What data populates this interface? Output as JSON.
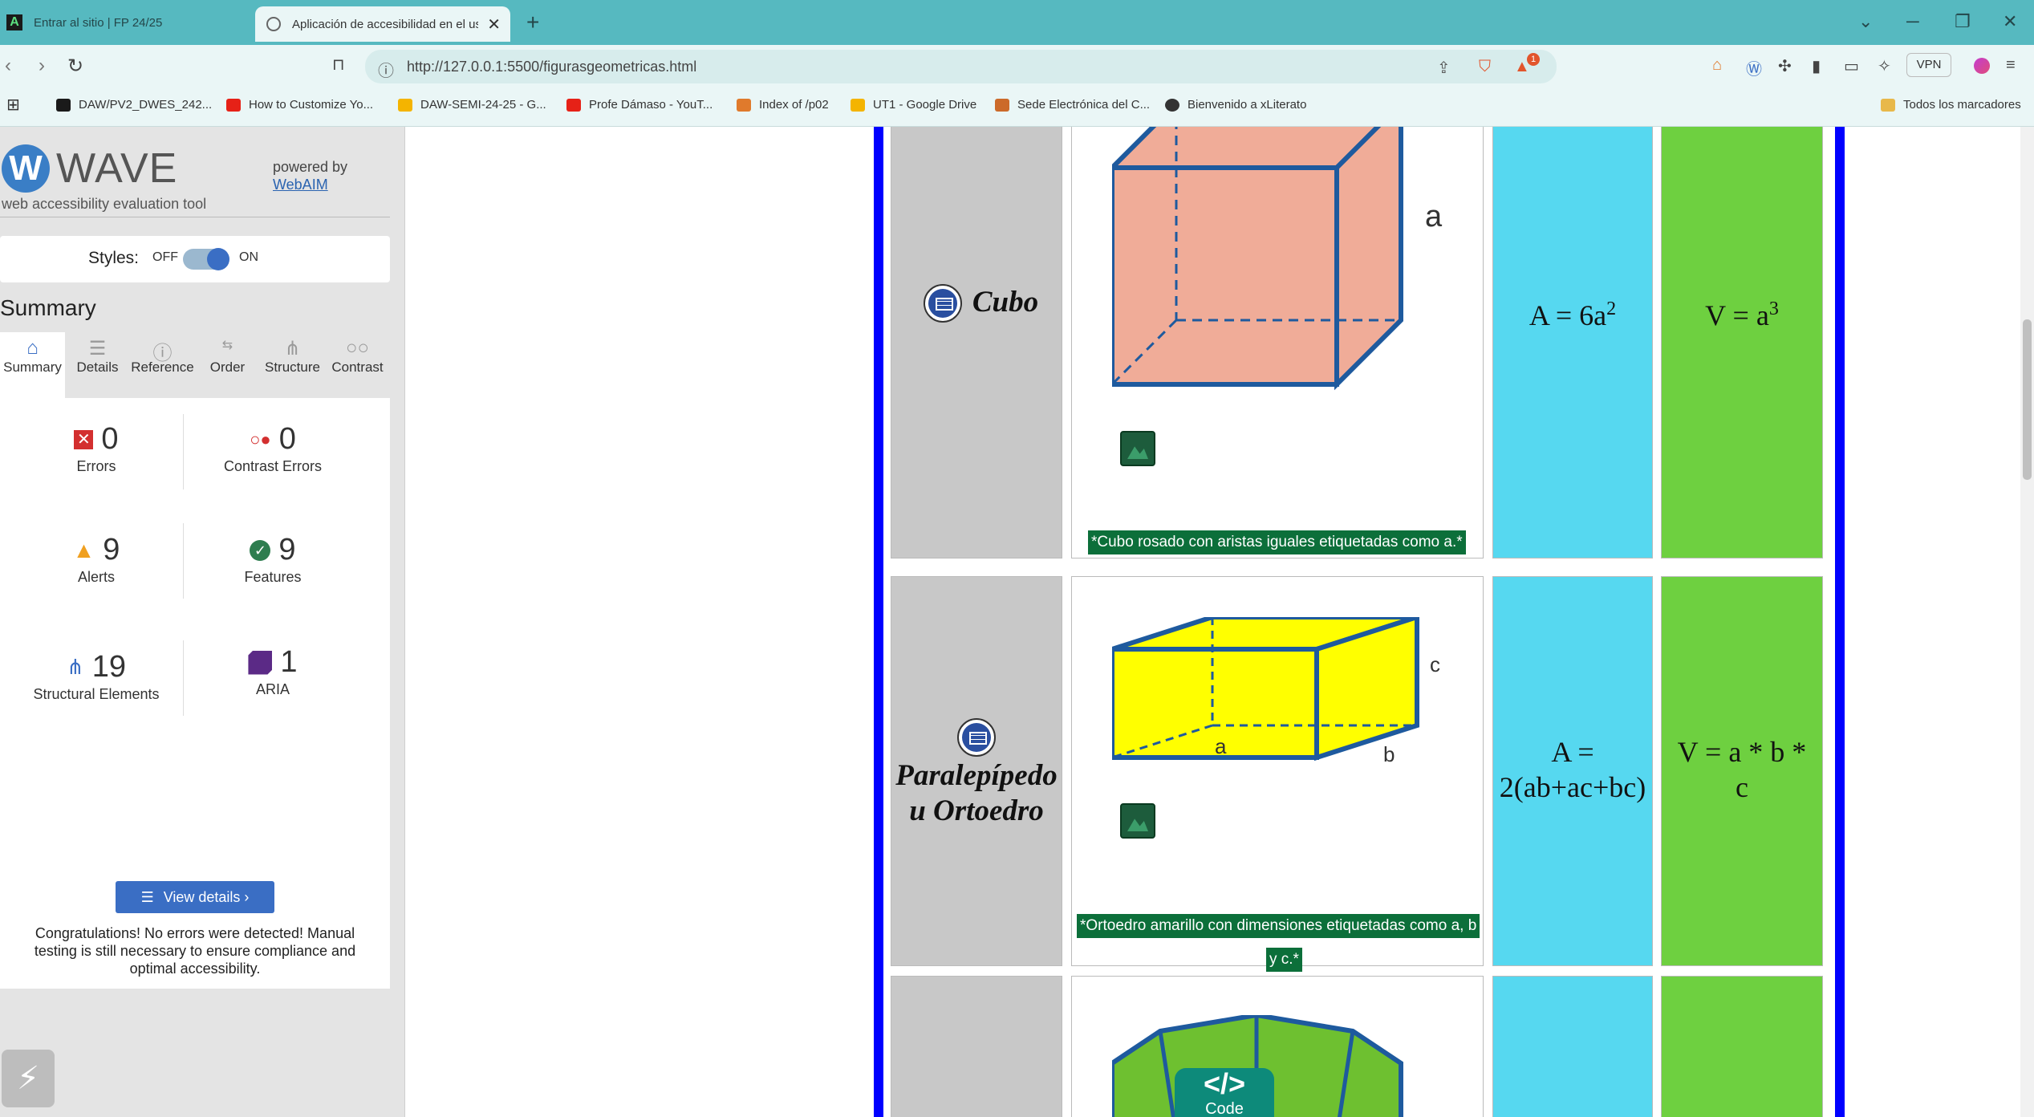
{
  "browser": {
    "tabs": [
      {
        "title": "Entrar al sitio | FP 24/25"
      },
      {
        "title": "Aplicación de accesibilidad en el uso"
      }
    ],
    "url": "http://127.0.0.1:5500/figurasgeometricas.html",
    "vpn_label": "VPN",
    "notification_count": "1"
  },
  "bookmarks": [
    {
      "label": "DAW/PV2_DWES_242...",
      "color": "#1a1a1a"
    },
    {
      "label": "How to Customize Yo...",
      "color": "#e62117"
    },
    {
      "label": "DAW-SEMI-24-25 - G...",
      "color": "#f4b400"
    },
    {
      "label": "Profe Dámaso - YouT...",
      "color": "#e62117"
    },
    {
      "label": "Index of /p02",
      "color": "#e07a2c"
    },
    {
      "label": "UT1 - Google Drive",
      "color": "#f4b400"
    },
    {
      "label": "Sede Electrónica del C...",
      "color": "#cc6a2a"
    },
    {
      "label": "Bienvenido a xLiterato",
      "color": "#333333"
    }
  ],
  "bookmarks_all": "Todos los marcadores",
  "wave": {
    "logo_text": "WAVE",
    "subtitle": "web accessibility evaluation tool",
    "powered_by": "powered by",
    "webaim": "WebAIM",
    "styles_label": "Styles:",
    "off_label": "OFF",
    "on_label": "ON",
    "summary_title": "Summary",
    "tabs": [
      {
        "label": "Summary"
      },
      {
        "label": "Details"
      },
      {
        "label": "Reference"
      },
      {
        "label": "Order"
      },
      {
        "label": "Structure"
      },
      {
        "label": "Contrast"
      }
    ],
    "stats": {
      "errors": {
        "value": "0",
        "label": "Errors"
      },
      "contrast_errors": {
        "value": "0",
        "label": "Contrast Errors"
      },
      "alerts": {
        "value": "9",
        "label": "Alerts"
      },
      "features": {
        "value": "9",
        "label": "Features"
      },
      "structural": {
        "value": "19",
        "label": "Structural Elements"
      },
      "aria": {
        "value": "1",
        "label": "ARIA"
      }
    },
    "view_details": "View details ›",
    "congrats": "Congratulations! No errors were detected! Manual testing is still necessary to ensure compliance and optimal accessibility."
  },
  "rows": [
    {
      "name": "Cubo",
      "area": "A = 6a",
      "area_sup": "2",
      "volume": "V = a",
      "volume_sup": "3",
      "alt": "*Cubo rosado con aristas iguales etiquetadas como a.*",
      "edge_label": "a"
    },
    {
      "name_line1": "Paralepípedo",
      "name_line2": "u Ortoedro",
      "area_line1": "A =",
      "area_line2": "2(ab+ac+bc)",
      "volume_line1": "V = a * b *",
      "volume_line2": "c",
      "alt_line1": "*Ortoedro amarillo con dimensiones etiquetadas como a, b",
      "alt_line2": "y c.*",
      "label_a": "a",
      "label_b": "b",
      "label_c": "c"
    }
  ],
  "code_badge": {
    "symbol": "</>",
    "label": "Code"
  }
}
